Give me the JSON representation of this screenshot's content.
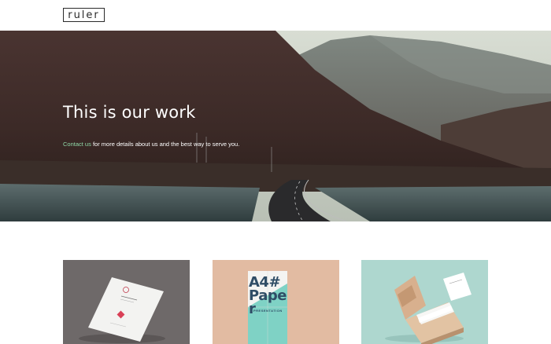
{
  "header": {
    "logo_text": "ruler"
  },
  "hero": {
    "title": "This is our work",
    "contact_link": "Contact us",
    "subtitle_rest": " for more details about us and the best way to serve you."
  },
  "cards": [
    {
      "name": "letterhead-mockup"
    },
    {
      "name": "a4-paper-poster",
      "poster_line1": "A4#",
      "poster_line2": "Pape",
      "poster_line3": "r",
      "poster_caption": "PRESENTATION"
    },
    {
      "name": "business-card-box-mockup"
    }
  ],
  "colors": {
    "accent_link": "#8fd9a8",
    "card1_bg": "#6e6969",
    "card2_bg": "#e2bba2",
    "card3_bg": "#aed7cf"
  }
}
